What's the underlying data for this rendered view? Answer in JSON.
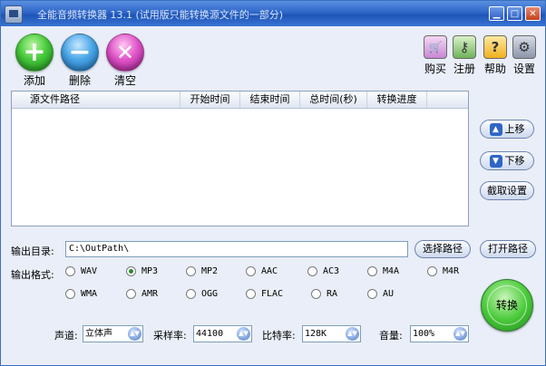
{
  "window": {
    "title": "全能音频转换器 13.1 (试用版只能转换源文件的一部分)",
    "controls": {
      "minimize": "▁",
      "maximize": "□",
      "close": "✕"
    }
  },
  "toolbar": {
    "left": [
      {
        "label": "添加",
        "icon": "plus-icon",
        "glyph": "+"
      },
      {
        "label": "删除",
        "icon": "minus-icon",
        "glyph": "−"
      },
      {
        "label": "清空",
        "icon": "clear-icon",
        "glyph": "✕"
      }
    ],
    "right": [
      {
        "label": "购买",
        "icon": "cart-icon",
        "glyph": "🛒"
      },
      {
        "label": "注册",
        "icon": "key-icon",
        "glyph": "⚷"
      },
      {
        "label": "帮助",
        "icon": "help-icon",
        "glyph": "?"
      },
      {
        "label": "设置",
        "icon": "tools-icon",
        "glyph": "⚙"
      }
    ]
  },
  "file_list": {
    "columns": [
      "源文件路径",
      "开始时间",
      "结束时间",
      "总时间(秒)",
      "转换进度"
    ],
    "rows": []
  },
  "side_buttons": {
    "move_up": "上移",
    "move_down": "下移",
    "capture_settings": "截取设置"
  },
  "output": {
    "dir_label": "输出目录:",
    "dir_value": "C:\\OutPath\\",
    "choose_path": "选择路径",
    "open_path": "打开路径",
    "format_label": "输出格式:",
    "formats": [
      "WAV",
      "MP3",
      "MP2",
      "AAC",
      "AC3",
      "M4A",
      "M4R",
      "WMA",
      "AMR",
      "OGG",
      "FLAC",
      "RA",
      "AU"
    ],
    "selected_format": "MP3"
  },
  "settings": {
    "channel_label": "声道:",
    "channel_value": "立体声",
    "samplerate_label": "采样率:",
    "samplerate_value": "44100",
    "bitrate_label": "比特率:",
    "bitrate_value": "128K",
    "volume_label": "音量:",
    "volume_value": "100%"
  },
  "convert_label": "转换"
}
